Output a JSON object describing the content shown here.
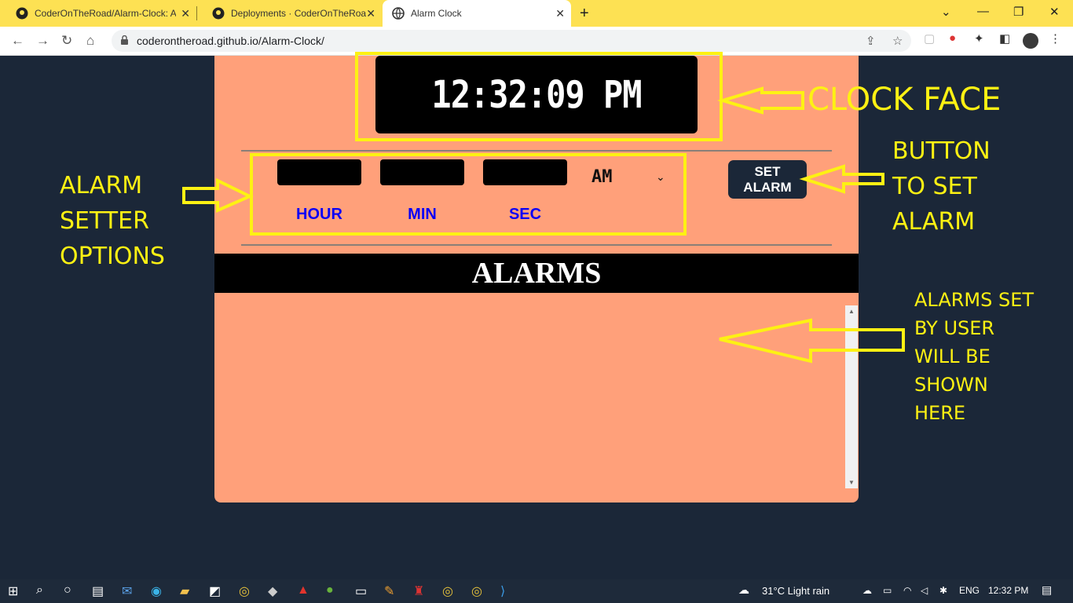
{
  "browser": {
    "tabs": [
      {
        "title": "CoderOnTheRoad/Alarm-Clock: A",
        "icon": "github-icon"
      },
      {
        "title": "Deployments · CoderOnTheRoad",
        "icon": "github-icon"
      },
      {
        "title": "Alarm Clock",
        "icon": "globe-icon"
      }
    ],
    "url": "coderontheroad.github.io/Alarm-Clock/"
  },
  "clock": {
    "time": "12:32:09 PM"
  },
  "alarm_setter": {
    "hour_label": "HOUR",
    "min_label": "MIN",
    "sec_label": "SEC",
    "ampm_value": "AM",
    "set_button": "SET ALARM"
  },
  "alarms": {
    "heading": "ALARMS"
  },
  "annotations": {
    "clock_face": "CLOCK FACE",
    "alarm_setter": [
      "ALARM",
      "SETTER",
      "OPTIONS"
    ],
    "button": [
      "BUTTON",
      "TO SET",
      "ALARM"
    ],
    "alarms_list": [
      "ALARMS SET",
      "BY USER",
      "WILL BE",
      "SHOWN",
      "HERE"
    ]
  },
  "taskbar": {
    "weather": "31°C  Light rain",
    "lang": "ENG",
    "time": "12:32 PM"
  },
  "colors": {
    "card": "#ffa07a",
    "page_bg": "#1b2738",
    "annotation": "#fdf113",
    "label_blue": "#0a00f5",
    "tabbar": "#fde153"
  }
}
